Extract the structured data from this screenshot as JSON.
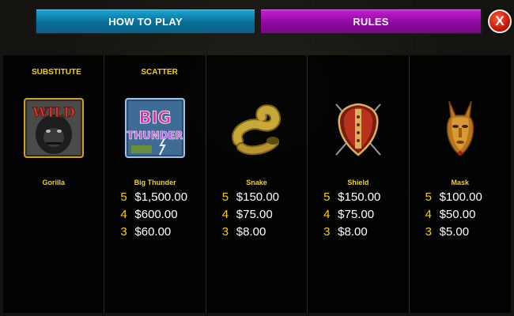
{
  "header": {
    "how_to_play": "HOW TO PLAY",
    "rules": "RULES",
    "close": "X"
  },
  "colors": {
    "accent_yellow": "#f2d20d",
    "tab_blue": "#0a6e96",
    "tab_purple": "#8e0aa0",
    "close_red": "#c21a0a"
  },
  "paytable": [
    {
      "label": "SUBSTITUTE",
      "icon": "wild-gorilla-icon",
      "wild_text": "WILD",
      "name": "Gorilla",
      "pays": []
    },
    {
      "label": "SCATTER",
      "icon": "big-thunder-icon",
      "logo_line1": "BIG",
      "logo_line2": "THUNDER",
      "name": "Big Thunder",
      "pays": [
        {
          "count": "5",
          "value": "$1,500.00"
        },
        {
          "count": "4",
          "value": "$600.00"
        },
        {
          "count": "3",
          "value": "$60.00"
        }
      ]
    },
    {
      "label": "",
      "icon": "snake-icon",
      "name": "Snake",
      "pays": [
        {
          "count": "5",
          "value": "$150.00"
        },
        {
          "count": "4",
          "value": "$75.00"
        },
        {
          "count": "3",
          "value": "$8.00"
        }
      ]
    },
    {
      "label": "",
      "icon": "shield-icon",
      "name": "Shield",
      "pays": [
        {
          "count": "5",
          "value": "$150.00"
        },
        {
          "count": "4",
          "value": "$75.00"
        },
        {
          "count": "3",
          "value": "$8.00"
        }
      ]
    },
    {
      "label": "",
      "icon": "mask-icon",
      "name": "Mask",
      "pays": [
        {
          "count": "5",
          "value": "$100.00"
        },
        {
          "count": "4",
          "value": "$50.00"
        },
        {
          "count": "3",
          "value": "$5.00"
        }
      ]
    }
  ]
}
